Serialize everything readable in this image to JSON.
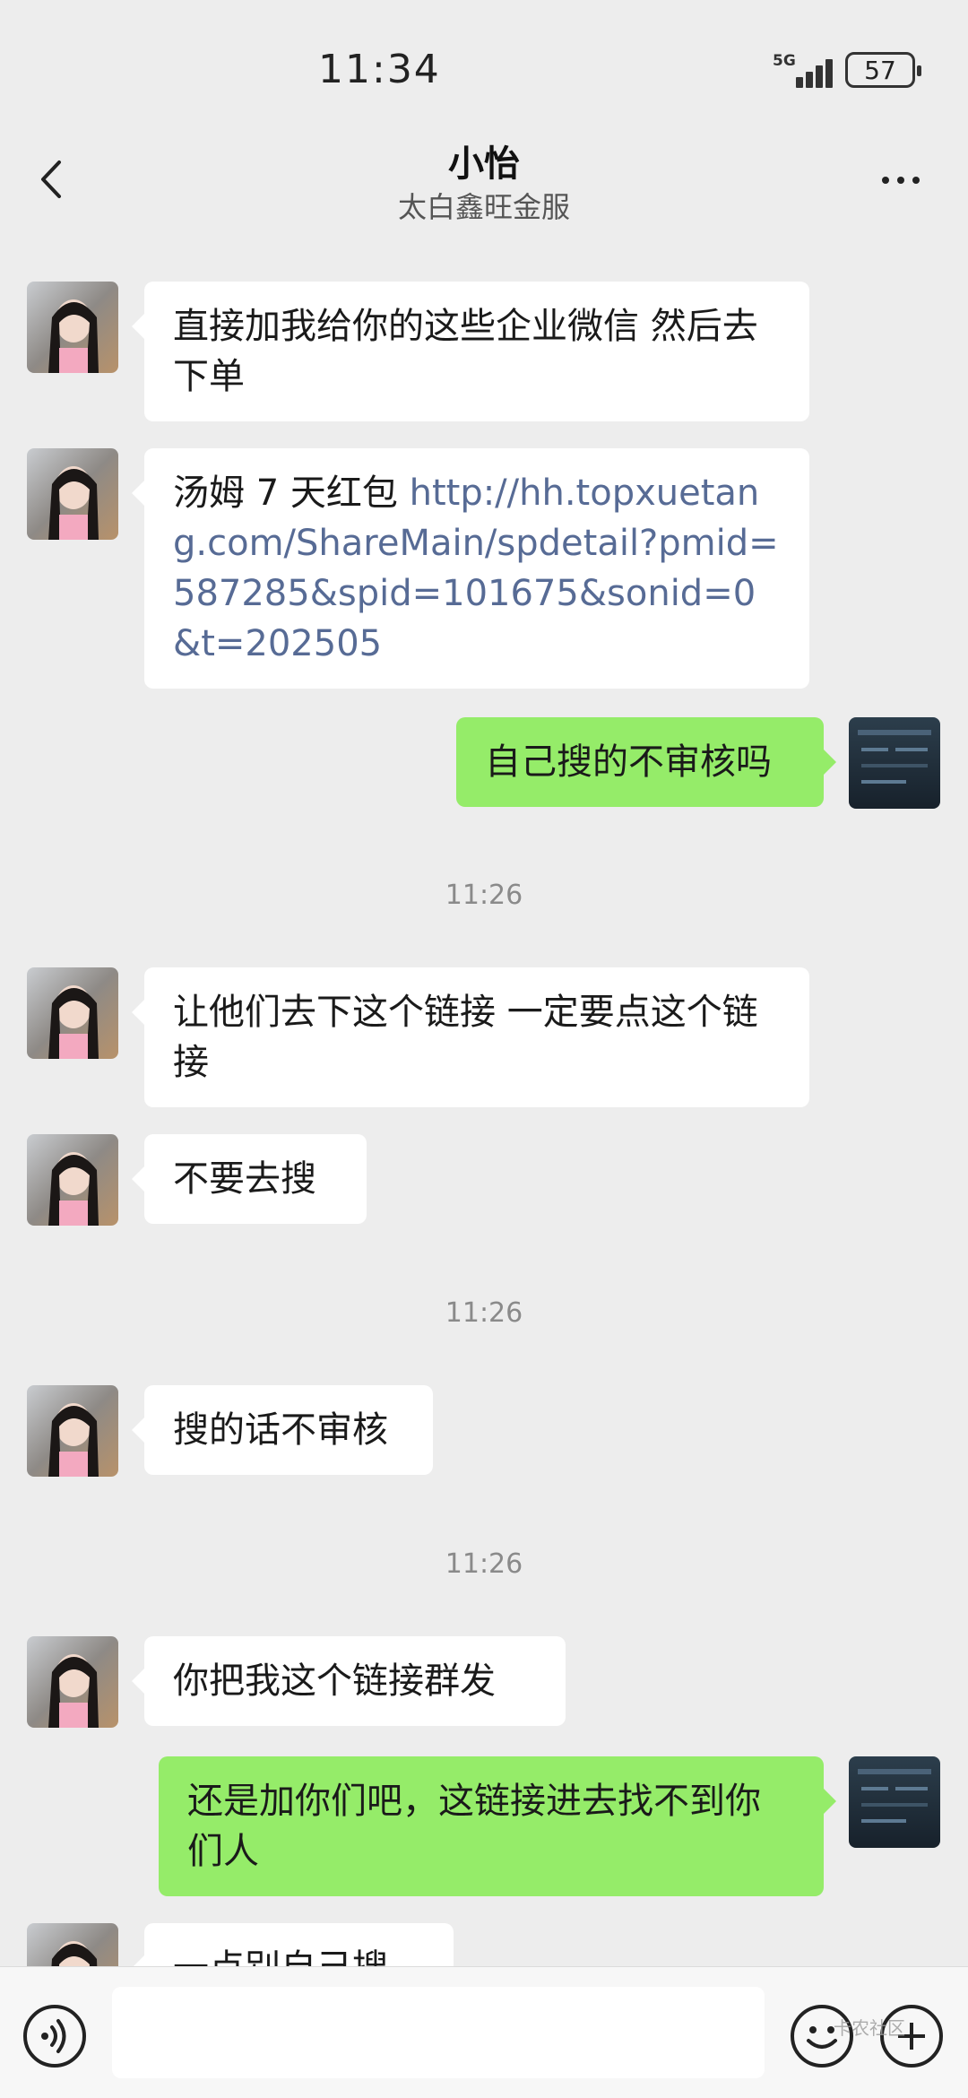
{
  "status_bar": {
    "time": "11:34",
    "network": "5G",
    "battery": "57"
  },
  "header": {
    "title": "小怡",
    "subtitle": "太白鑫旺金服"
  },
  "messages": [
    {
      "side": "in",
      "text": "直接加我给你的这些企业微信 然后去下单"
    },
    {
      "side": "in",
      "prefix": "汤姆 7 天红包 ",
      "link": "http://hh.topxuetang.com/ShareMain/spdetail?pmid=587285&spid=101675&sonid=0&t=202505"
    },
    {
      "side": "out",
      "text": "自己搜的不审核吗"
    },
    {
      "side": "time",
      "text": "11:26"
    },
    {
      "side": "in",
      "text": "让他们去下这个链接  一定要点这个链接"
    },
    {
      "side": "in",
      "text": "不要去搜"
    },
    {
      "side": "time",
      "text": "11:26"
    },
    {
      "side": "in",
      "text": "搜的话不审核"
    },
    {
      "side": "time",
      "text": "11:26"
    },
    {
      "side": "in",
      "text": "你把我这个链接群发"
    },
    {
      "side": "out",
      "text": "还是加你们吧，这链接进去找不到你们人"
    },
    {
      "side": "in",
      "text": "一点别自己搜"
    }
  ],
  "bottom_bar": {
    "input_placeholder": "",
    "watermark": "卡农社区"
  },
  "icons": {
    "back": "chevron-left-icon",
    "more": "more-dots-icon",
    "voice": "voice-icon",
    "emoji": "emoji-icon",
    "plus": "plus-icon"
  },
  "colors": {
    "background": "#ededed",
    "incoming": "#ffffff",
    "outgoing": "#95ec69",
    "link": "#576b95"
  }
}
